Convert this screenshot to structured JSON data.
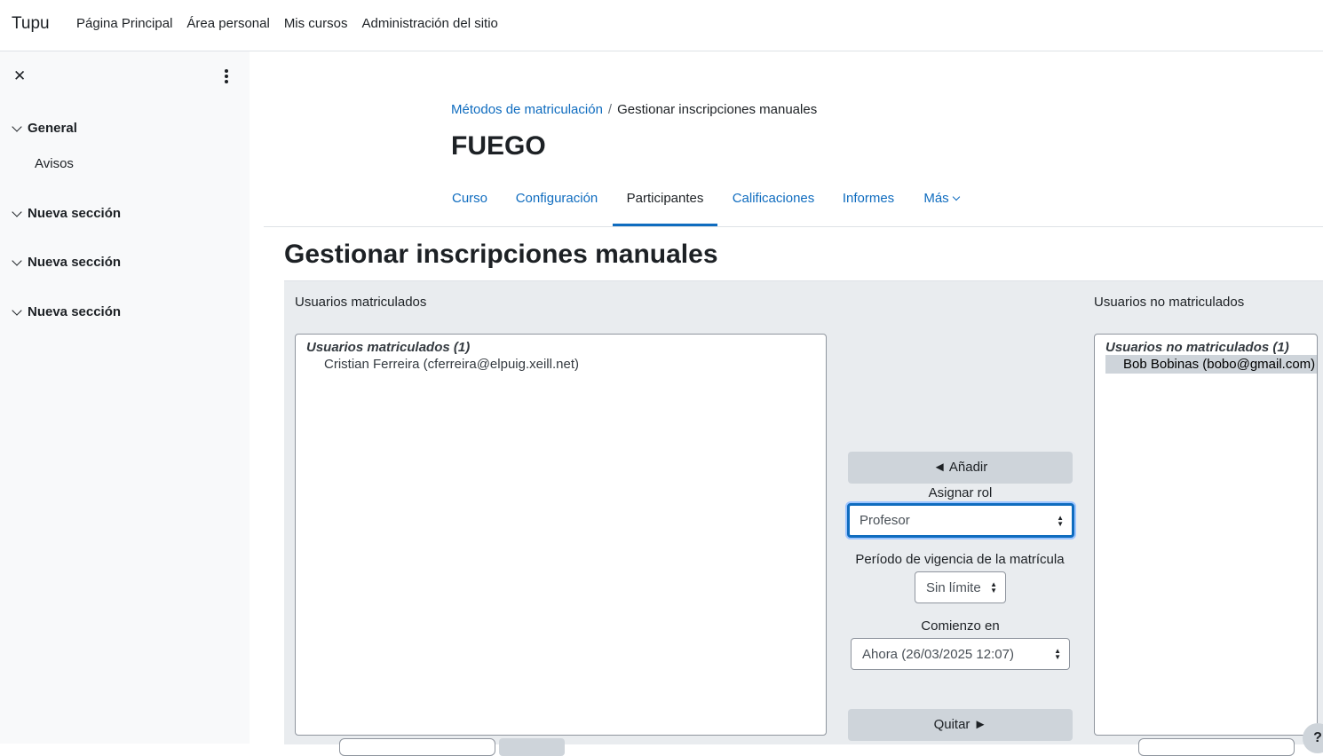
{
  "navbar": {
    "brand": "Tupu",
    "links": [
      "Página Principal",
      "Área personal",
      "Mis cursos",
      "Administración del sitio"
    ]
  },
  "drawer": {
    "close_icon": "close-icon",
    "menu_icon": "kebab-menu-icon",
    "sections": [
      {
        "label": "General",
        "items": [
          "Avisos"
        ]
      },
      {
        "label": "Nueva sección",
        "items": []
      },
      {
        "label": "Nueva sección",
        "items": []
      },
      {
        "label": "Nueva sección",
        "items": []
      }
    ]
  },
  "breadcrumb": {
    "link": "Métodos de matriculación",
    "separator": "/",
    "current": "Gestionar inscripciones manuales"
  },
  "course": {
    "name": "FUEGO"
  },
  "tabs": [
    {
      "label": "Curso"
    },
    {
      "label": "Configuración"
    },
    {
      "label": "Participantes",
      "active": true
    },
    {
      "label": "Calificaciones"
    },
    {
      "label": "Informes"
    },
    {
      "label": "Más"
    }
  ],
  "page": {
    "title": "Gestionar inscripciones manuales"
  },
  "enrolled": {
    "label": "Usuarios matriculados",
    "group": "Usuarios matriculados (1)",
    "users": [
      "Cristian Ferreira (cferreira@elpuig.xeill.net)"
    ]
  },
  "not_enrolled": {
    "label": "Usuarios no matriculados",
    "group": "Usuarios no matriculados (1)",
    "users": [
      "Bob Bobinas (bobo@gmail.com)"
    ]
  },
  "controls": {
    "add_button": "◄ Añadir",
    "role_label": "Asignar rol",
    "role_value": "Profesor",
    "period_label": "Período de vigencia de la matrícula",
    "period_value": "Sin límite",
    "start_label": "Comienzo en",
    "start_value": "Ahora (26/03/2025 12:07)",
    "remove_button": "Quitar ►"
  },
  "help": {
    "label": "?"
  },
  "colors": {
    "link": "#0f6cbf",
    "panel": "#e9ecef",
    "button": "#ced4da"
  }
}
